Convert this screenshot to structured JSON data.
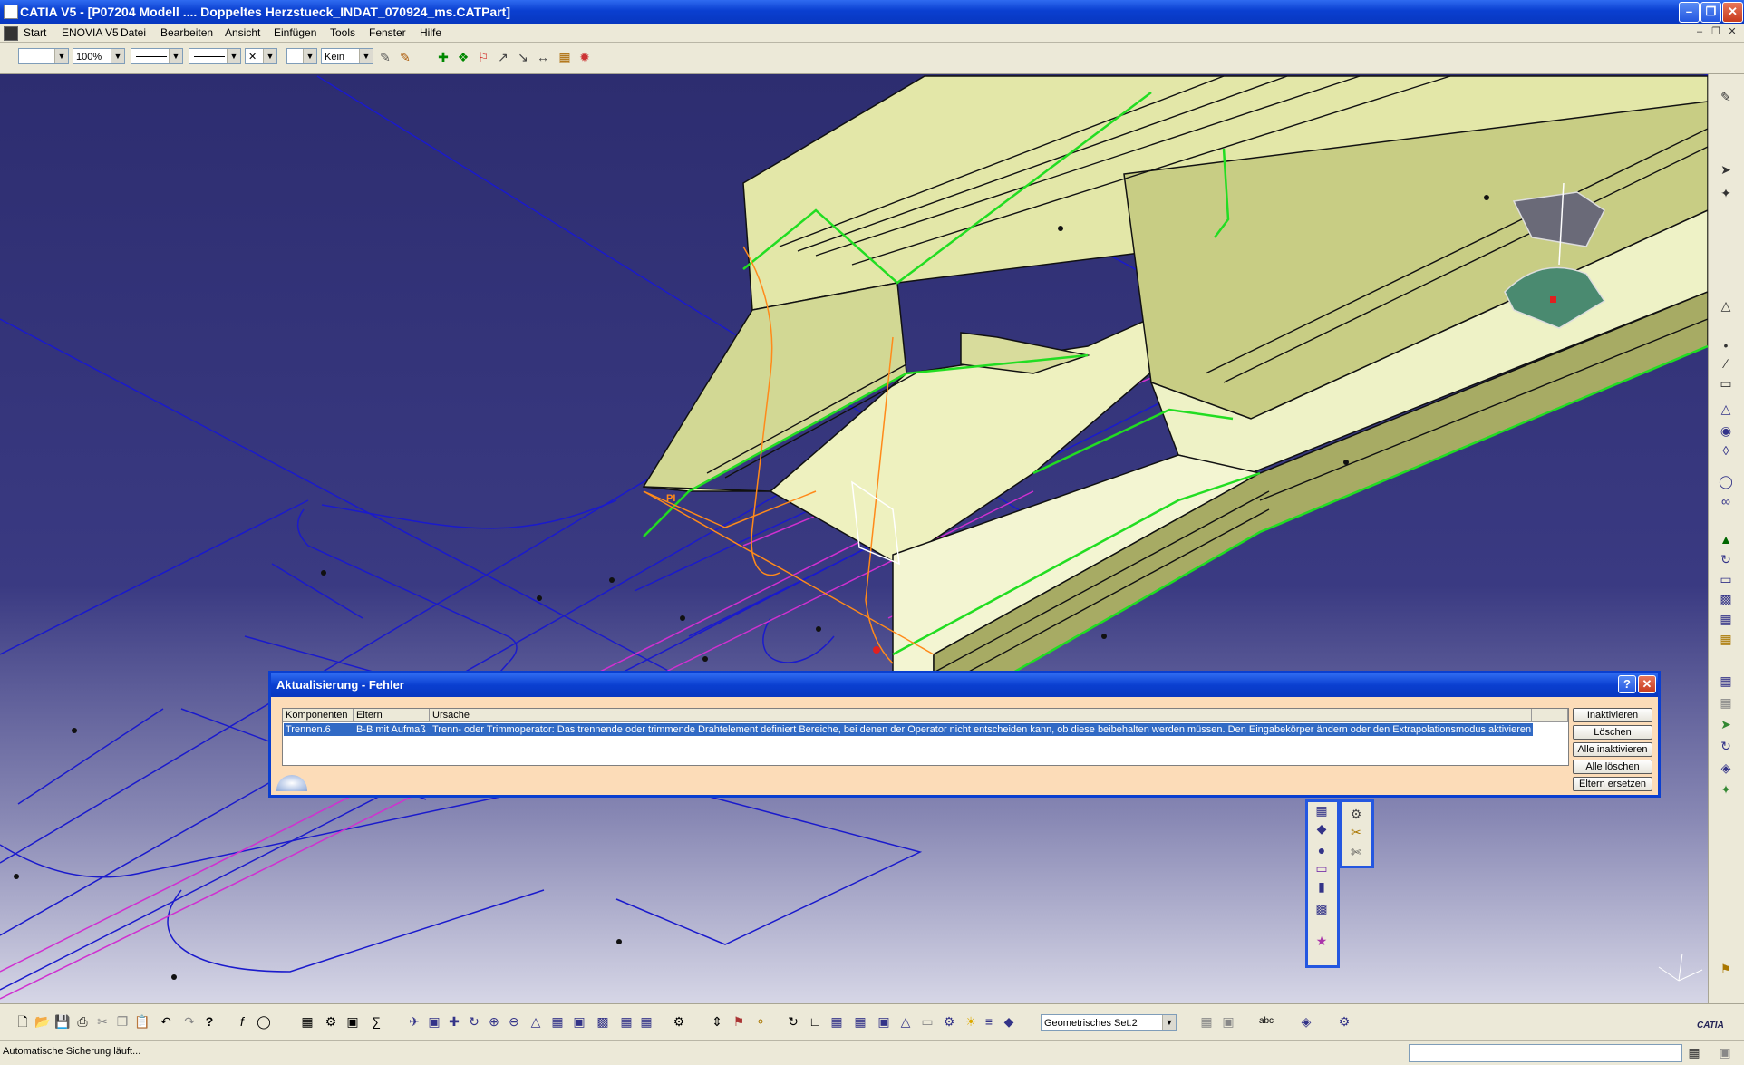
{
  "titlebar": {
    "title": "CATIA V5 - [P07204 Modell .... Doppeltes Herzstueck_INDAT_070924_ms.CATPart]"
  },
  "menubar": {
    "items": [
      "Start",
      "ENOVIA V5",
      "Datei",
      "Bearbeiten",
      "Ansicht",
      "Einfügen",
      "Tools",
      "Fenster",
      "Hilfe"
    ]
  },
  "toolbar_top": {
    "zoom": "100%",
    "layer": "Kein"
  },
  "viewport": {
    "annotation": "PI"
  },
  "dialog": {
    "title": "Aktualisierung - Fehler",
    "columns": [
      "Komponenten",
      "Eltern",
      "Ursache"
    ],
    "rows": [
      {
        "komponenten": "Trennen.6",
        "eltern": "B-B mit Aufmaß",
        "ursache": "Trenn- oder Trimmoperator: Das trennende oder trimmende Drahtelement definiert Bereiche, bei denen der Operator  nicht entscheiden  kann, ob diese beibehalten werden müssen. Den Eingabekörper ändern oder den Extrapolationsmodus aktivieren."
      }
    ],
    "buttons": [
      "Inaktivieren",
      "Löschen",
      "Alle inaktivieren",
      "Alle löschen",
      "Eltern ersetzen"
    ]
  },
  "toolbar_bottom": {
    "geometry_set": "Geometrisches Set.2"
  },
  "status": {
    "text": "Automatische Sicherung läuft..."
  },
  "brand": {
    "logo": "CATIA"
  },
  "colors": {
    "title_blue": "#0a3fd0",
    "viewport_top": "#2d2d70",
    "selection": "#316ac5",
    "dialog_bg": "#fcdcb8"
  }
}
